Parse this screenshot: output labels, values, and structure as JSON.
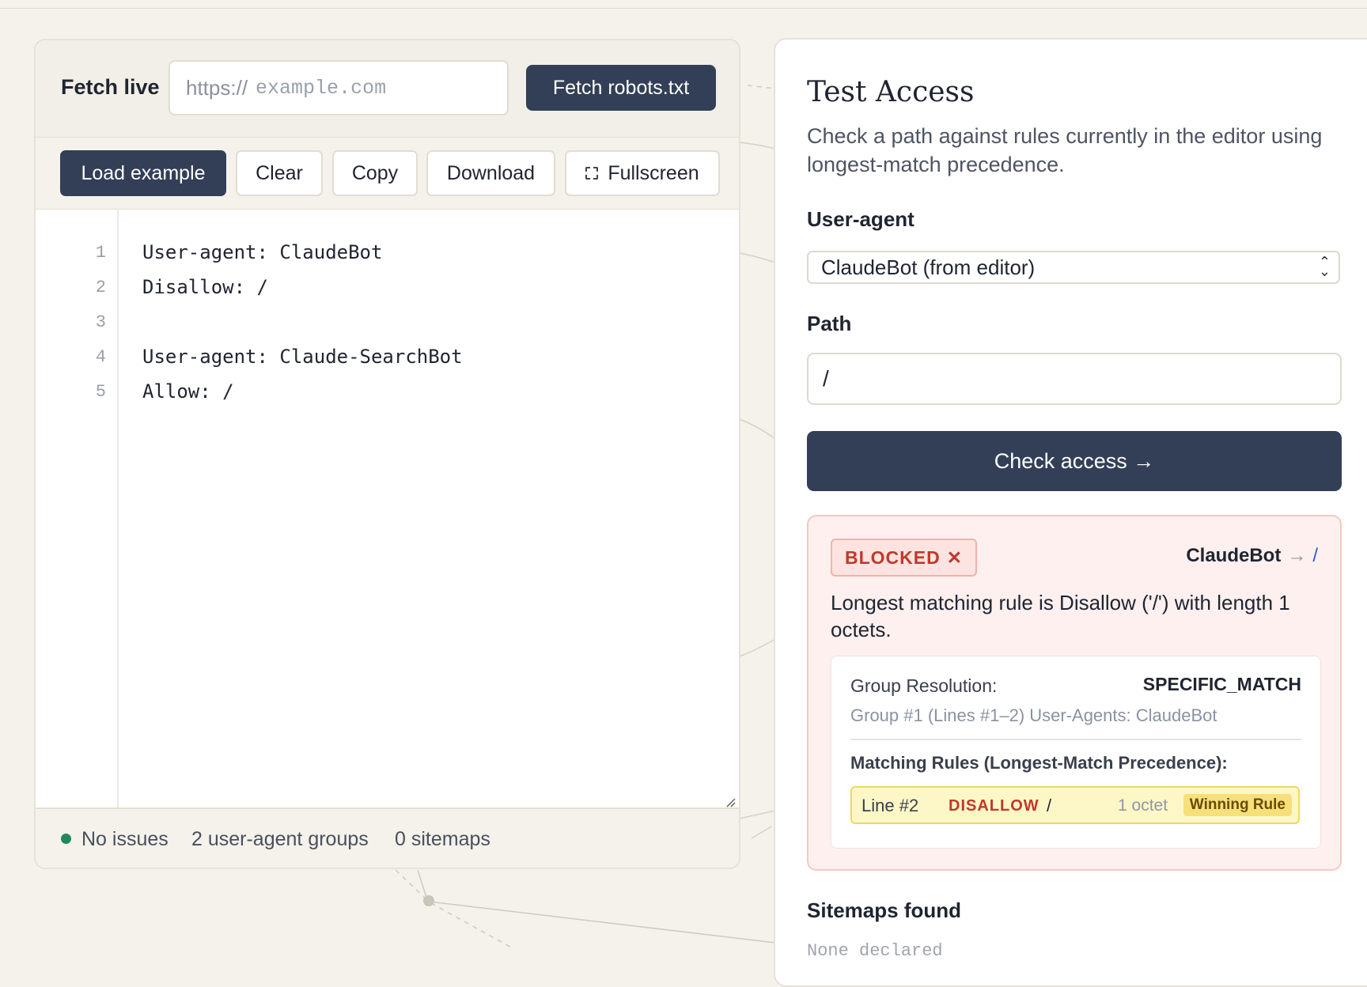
{
  "fetch": {
    "label": "Fetch live",
    "url_prefix": "https://",
    "url_placeholder": "example.com",
    "button": "Fetch robots.txt"
  },
  "toolbar": {
    "load_example": "Load example",
    "clear": "Clear",
    "copy": "Copy",
    "download": "Download",
    "fullscreen": "Fullscreen"
  },
  "editor": {
    "line_numbers": [
      "1",
      "2",
      "3",
      "4",
      "5"
    ],
    "lines": [
      "User-agent: ClaudeBot",
      "Disallow: /",
      "",
      "User-agent: Claude-SearchBot",
      "Allow: /"
    ]
  },
  "status": {
    "issues": "No issues",
    "groups": "2 user-agent groups",
    "sitemaps": "0 sitemaps",
    "ok_color": "#1e8a5a"
  },
  "test": {
    "title": "Test Access",
    "description": "Check a path against rules currently in the editor using longest-match precedence.",
    "user_agent_label": "User-agent",
    "user_agent_value": "ClaudeBot (from editor)",
    "path_label": "Path",
    "path_value": "/",
    "check_button": "Check access →",
    "result": {
      "status": "BLOCKED",
      "status_icon": "✕",
      "agent": "ClaudeBot",
      "arrow": "→",
      "path": "/",
      "reason": "Longest matching rule is Disallow ('/') with length 1 octets.",
      "group_resolution_label": "Group Resolution:",
      "group_resolution_value": "SPECIFIC_MATCH",
      "group_detail": "Group #1 (Lines #1–2) User-Agents: ClaudeBot",
      "matching_rules_label": "Matching Rules (Longest-Match Precedence):",
      "rule": {
        "line": "Line #2",
        "type": "DISALLOW",
        "path": "/",
        "length": "1 octet",
        "badge": "Winning Rule"
      }
    },
    "sitemaps_label": "Sitemaps found",
    "sitemaps_value": "None declared"
  },
  "colors": {
    "primary_dark": "#333f57",
    "blocked_red": "#c0392b",
    "winning_yellow": "#fdf7c8"
  }
}
